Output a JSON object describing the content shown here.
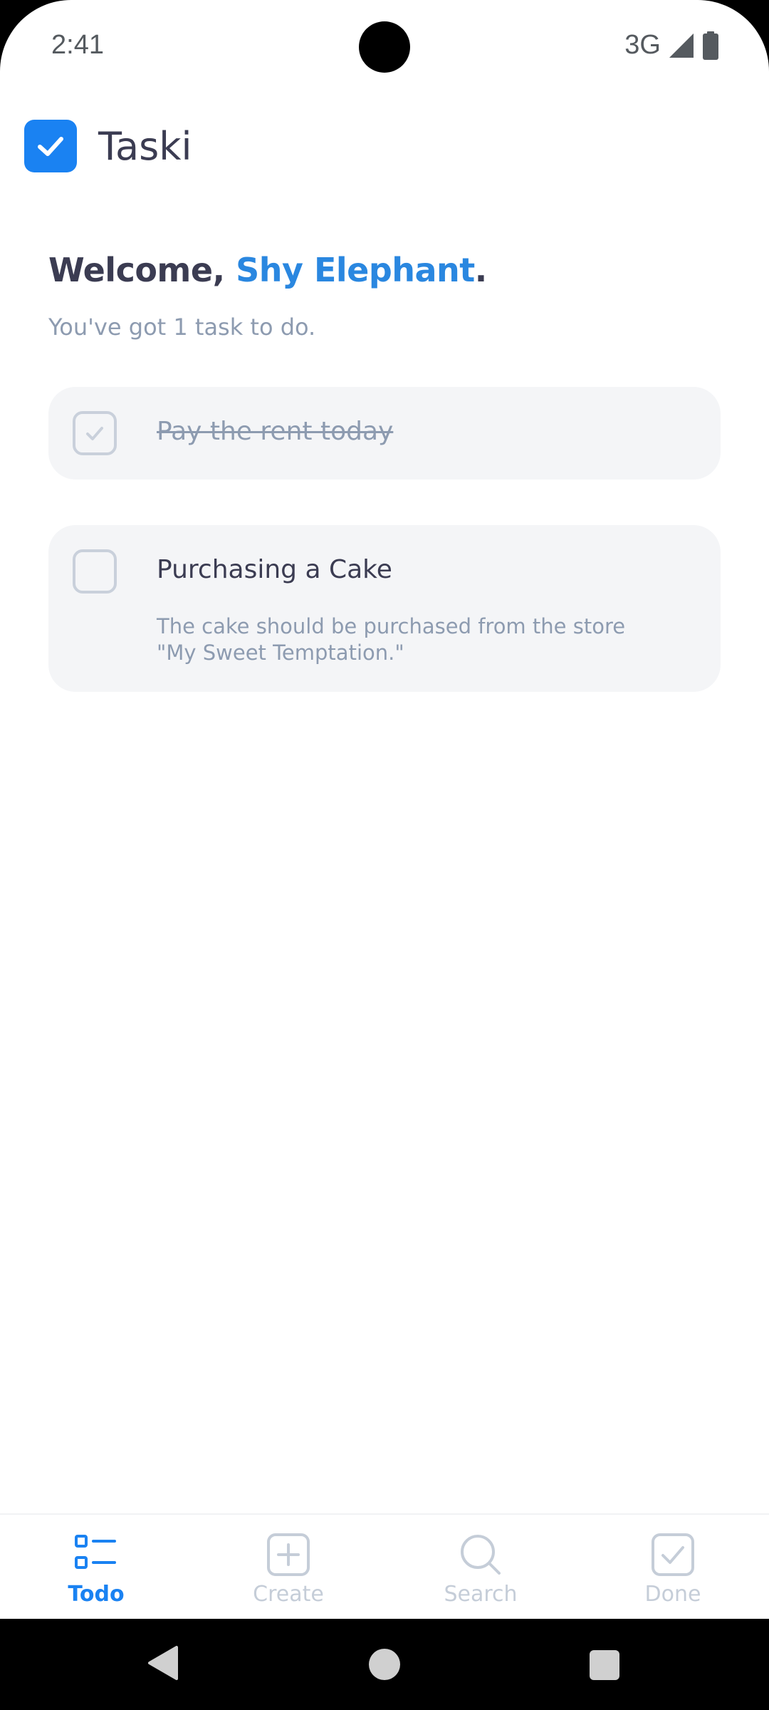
{
  "status_bar": {
    "time": "2:41",
    "network": "3G"
  },
  "header": {
    "app_name": "Taski",
    "logo_icon": "checkbox-checked-icon"
  },
  "welcome": {
    "greeting": "Welcome, ",
    "name": "Shy Elephant",
    "punctuation": ".",
    "subtitle": "You've got 1 task to do."
  },
  "tasks": [
    {
      "title": "Pay the rent today",
      "done": true
    },
    {
      "title": "Purchasing a Cake",
      "description": "The cake should be purchased from the store \"My Sweet Temptation.\"",
      "done": false
    }
  ],
  "bottom_nav": {
    "active": "Todo",
    "items": [
      {
        "label": "Todo",
        "icon": "list-icon"
      },
      {
        "label": "Create",
        "icon": "plus-square-icon"
      },
      {
        "label": "Search",
        "icon": "search-icon"
      },
      {
        "label": "Done",
        "icon": "check-square-icon"
      }
    ]
  },
  "colors": {
    "accent": "#1a82f2",
    "name_highlight": "#2a87e0",
    "text_dark": "#3b3c52",
    "text_muted": "#8d9bb0",
    "card_bg": "#f4f5f7",
    "nav_inactive": "#c5cdd8"
  }
}
